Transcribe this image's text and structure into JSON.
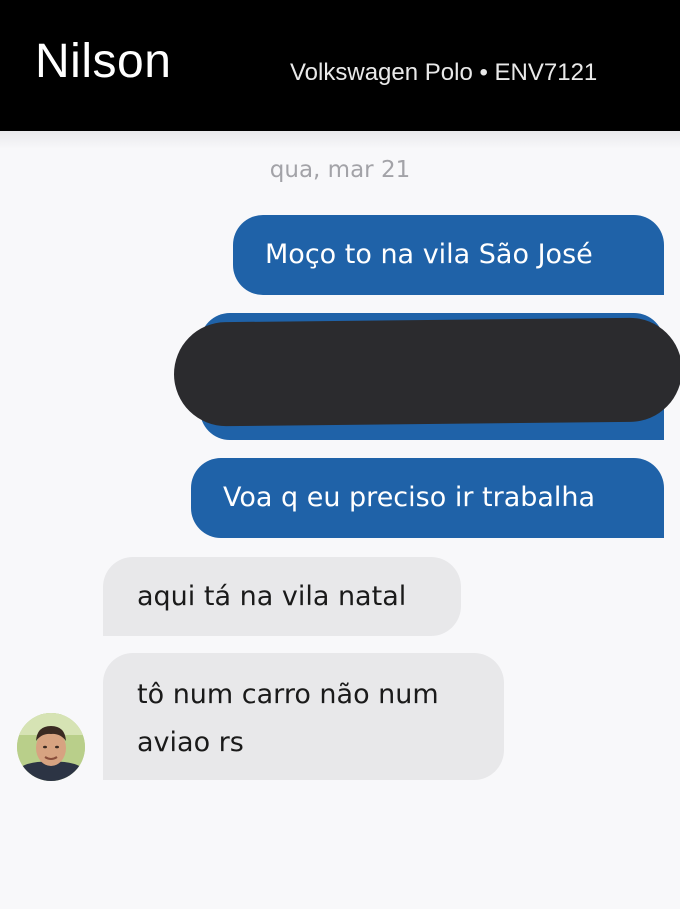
{
  "header": {
    "driver_name": "Nilson",
    "vehicle": "Volkswagen Polo • ENV7121"
  },
  "date_label": "qua, mar 21",
  "messages": [
    {
      "direction": "sent",
      "text": "Moço to na vila São José"
    },
    {
      "direction": "sent",
      "redacted": true,
      "text": ""
    },
    {
      "direction": "sent",
      "text": "Voa q eu preciso ir trabalha"
    },
    {
      "direction": "received",
      "text": "aqui tá na vila natal"
    },
    {
      "direction": "received",
      "lines": [
        "tô num carro não num",
        "aviao rs"
      ]
    }
  ],
  "colors": {
    "header_bg": "#000000",
    "sent_bubble": "#1f62a8",
    "received_bubble": "#e8e8ea",
    "background": "#f8f8fa"
  }
}
